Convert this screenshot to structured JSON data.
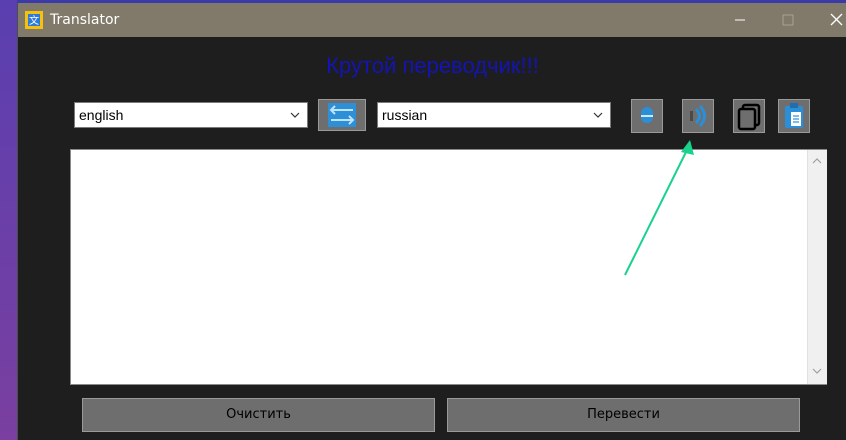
{
  "window": {
    "title": "Translator",
    "titlebar_color": "#81796a"
  },
  "header": {
    "title": "Крутой переводчик!!!",
    "title_color": "#1414b4"
  },
  "languages": {
    "from": "english",
    "to": "russian"
  },
  "toolbar": {
    "swap_icon": "swap-icon",
    "mic_icon": "microphone-icon",
    "speaker_icon": "speaker-icon",
    "copy_icon": "copy-icon",
    "paste_icon": "paste-icon"
  },
  "input": {
    "text": ""
  },
  "buttons": {
    "clear": "Очистить",
    "translate": "Перевести"
  },
  "annotation": {
    "arrow_color": "#19d28c"
  }
}
